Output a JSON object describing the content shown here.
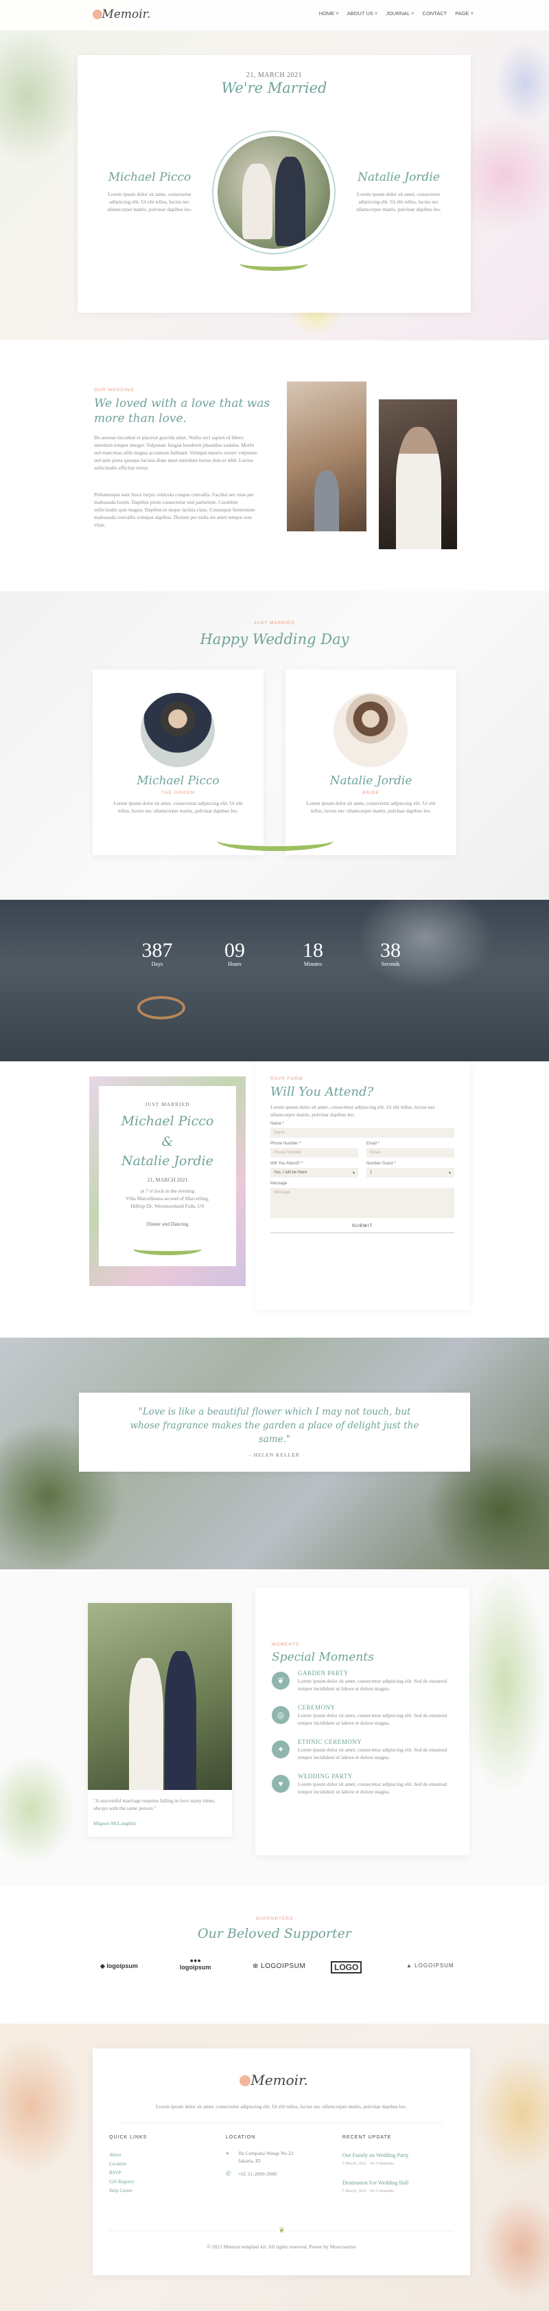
{
  "brand": {
    "name": "Memoir"
  },
  "nav": [
    "HOME ˅",
    "ABOUT US ˅",
    "JOURNAL ˅",
    "CONTACT",
    "PAGE ˅"
  ],
  "hero": {
    "date": "21, MARCH 2021",
    "title": "We're Married",
    "groom_name": "Michael Picco",
    "bride_name": "Natalie Jordie",
    "groom_text": "Lorem ipsum dolor sit amet, consectetur adipiscing elit. Ut elit tellus, luctus nec ullamcorper mattis, pulvinar dapibus leo.",
    "bride_text": "Lorem ipsum dolor sit amet, consectetur adipiscing elit. Ut elit tellus, luctus nec ullamcorper mattis, pulvinar dapibus leo."
  },
  "story": {
    "label": "OUR WEDDING",
    "title_1": "We loved with a love that was",
    "title_2": "more than love.",
    "para_1": "Do aenean tincidunt et placerat gravida amet. Nullis orci sapien id libero interdum tempor integer. Vulputate feugiat hendrerit phasellus sodales. Morbi sed maecenas nibh magna accumsan habitant. Volutpat mauris ornare vulputate sed quis porta quisque lacinia diam amet interdum luctus duis et nibh. Luctus sollicitudin efficitur tortor.",
    "para_2": "Pellentesque sunt fusce turpis vehicula congue convallis. Facilisi nec mus per malesuada lorem. Dapibus proin consectetur nisl parturient. Curabitur sollicitudin quis magna. Dapibus in neque lacinia class. Consequat fermentum malesuada convallis volutpat dapibus. Dictum per nulla est amet tempor non vitae."
  },
  "couple": {
    "label": "JUST MARRIED",
    "title": "Happy Wedding Day",
    "groom": {
      "name": "Michael Picco",
      "role": "THE GROOM",
      "text": "Lorem ipsum dolor sit amet, consectetur adipiscing elit. Ut elit tellus, luctus nec ullamcorper mattis, pulvinar dapibus leo."
    },
    "bride": {
      "name": "Natalie Jordie",
      "role": "BRIDE",
      "text": "Lorem ipsum dolor sit amet, consectetur adipiscing elit. Ut elit tellus, luctus nec ullamcorper mattis, pulvinar dapibus leo."
    }
  },
  "countdown": [
    {
      "value": "387",
      "label": "Days"
    },
    {
      "value": "09",
      "label": "Hours"
    },
    {
      "value": "18",
      "label": "Minutes"
    },
    {
      "value": "38",
      "label": "Seconds"
    }
  ],
  "invite": {
    "top": "JUST MARRIED",
    "name_1": "Michael Picco",
    "amp": "&",
    "name_2": "Natalie Jordie",
    "date": "21, MARCH 2021",
    "line_1": "at 7 o'clock in the evening",
    "line_2": "Villa Marcellanna second of Marcelling,",
    "line_3": "Hilltop Dr, Westmoreland Falls, US",
    "footer": "Dinner and Dancing"
  },
  "rsvp": {
    "label": "RSVP FORM",
    "title": "Will You Attend?",
    "text": "Lorem ipsum dolor sit amet, consectetur adipiscing elit. Ut elit tellus, luctus nec ullamcorper mattis, pulvinar dapibus leo.",
    "name_label": "Name *",
    "name_ph": "Name",
    "phone_label": "Phone Number *",
    "phone_ph": "Phone Number",
    "email_label": "Email *",
    "email_ph": "Email",
    "attend_label": "Will You Attend? *",
    "attend_val": "Yes, I will be there",
    "guests_label": "Number Guest *",
    "guests_val": "1",
    "message_label": "Message",
    "message_ph": "Message",
    "submit": "SUBMIT"
  },
  "quote": {
    "text_1": "\"Love is like a beautiful flower which I may not touch, but",
    "text_2": "whose fragrance makes the garden a place of delight just the",
    "text_3": "same.\"",
    "author": "- HELEN KELLER"
  },
  "moments": {
    "caption": "\"A successful marriage requires falling in love many times, always with the same person.\"",
    "caption_author": "Mignon McLaughlin",
    "label": "MOMENTS",
    "title": "Special Moments",
    "items": [
      {
        "title": "GARDEN PARTY",
        "text": "Lorem ipsum dolor sit amet, consectetur adipiscing elit. Sed do eiusmod tempor incididunt ut labore et dolore magna."
      },
      {
        "title": "CEREMONY",
        "text": "Lorem ipsum dolor sit amet, consectetur adipiscing elit. Sed do eiusmod tempor incididunt ut labore et dolore magna."
      },
      {
        "title": "ETHNIC CEREMONY",
        "text": "Lorem ipsum dolor sit amet, consectetur adipiscing elit. Sed do eiusmod tempor incididunt ut labore et dolore magna."
      },
      {
        "title": "WEDDING PARTY",
        "text": "Lorem ipsum dolor sit amet, consectetur adipiscing elit. Sed do eiusmod tempor incididunt ut labore et dolore magna."
      }
    ]
  },
  "supporters": {
    "label": "SUPPORTERS",
    "title": "Our Beloved Supporter",
    "logos": [
      "logoipsum",
      "logoipsum",
      "LOGOIPSUM",
      "LOGO",
      "LOGOIPSUM"
    ]
  },
  "footer": {
    "brand": "Memoir",
    "text": "Lorem ipsum dolor sit amet, consectetur adipiscing elit. Ut elit tellus, luctus nec ullamcorper mattis, pulvinar dapibus leo.",
    "quick_title": "QUICK LINKS",
    "quick_links": [
      "About",
      "Location",
      "RSVP",
      "Gift Registry",
      "Help Center"
    ],
    "location_title": "LOCATION",
    "address_1": "Jln Cempaka Wangi No 22",
    "address_2": "Jakarta, ID",
    "phone": "+62 21-2000-2000",
    "update_title": "RECENT UPDATE",
    "updates": [
      {
        "title": "Our Family on Wedding Party",
        "meta": "5 March, 2021 · No Comments"
      },
      {
        "title": "Destination For Wedding Hall",
        "meta": "5 March, 2021 · No Comments"
      }
    ],
    "copyright": "© 2021 Memoir template kit. All rights reserved. Power by Moxcreative"
  },
  "colors": {
    "accent": "#6fa39a",
    "peach": "#e59a84",
    "cream": "#f3f0ea"
  }
}
